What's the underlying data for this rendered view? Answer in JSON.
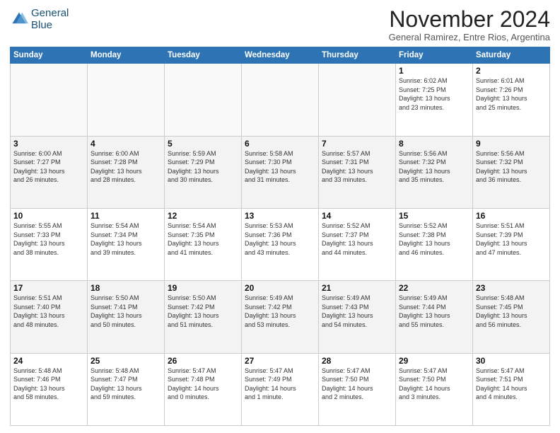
{
  "logo": {
    "line1": "General",
    "line2": "Blue"
  },
  "header": {
    "title": "November 2024",
    "subtitle": "General Ramirez, Entre Rios, Argentina"
  },
  "weekdays": [
    "Sunday",
    "Monday",
    "Tuesday",
    "Wednesday",
    "Thursday",
    "Friday",
    "Saturday"
  ],
  "weeks": [
    [
      {
        "day": "",
        "info": ""
      },
      {
        "day": "",
        "info": ""
      },
      {
        "day": "",
        "info": ""
      },
      {
        "day": "",
        "info": ""
      },
      {
        "day": "",
        "info": ""
      },
      {
        "day": "1",
        "info": "Sunrise: 6:02 AM\nSunset: 7:25 PM\nDaylight: 13 hours\nand 23 minutes."
      },
      {
        "day": "2",
        "info": "Sunrise: 6:01 AM\nSunset: 7:26 PM\nDaylight: 13 hours\nand 25 minutes."
      }
    ],
    [
      {
        "day": "3",
        "info": "Sunrise: 6:00 AM\nSunset: 7:27 PM\nDaylight: 13 hours\nand 26 minutes."
      },
      {
        "day": "4",
        "info": "Sunrise: 6:00 AM\nSunset: 7:28 PM\nDaylight: 13 hours\nand 28 minutes."
      },
      {
        "day": "5",
        "info": "Sunrise: 5:59 AM\nSunset: 7:29 PM\nDaylight: 13 hours\nand 30 minutes."
      },
      {
        "day": "6",
        "info": "Sunrise: 5:58 AM\nSunset: 7:30 PM\nDaylight: 13 hours\nand 31 minutes."
      },
      {
        "day": "7",
        "info": "Sunrise: 5:57 AM\nSunset: 7:31 PM\nDaylight: 13 hours\nand 33 minutes."
      },
      {
        "day": "8",
        "info": "Sunrise: 5:56 AM\nSunset: 7:32 PM\nDaylight: 13 hours\nand 35 minutes."
      },
      {
        "day": "9",
        "info": "Sunrise: 5:56 AM\nSunset: 7:32 PM\nDaylight: 13 hours\nand 36 minutes."
      }
    ],
    [
      {
        "day": "10",
        "info": "Sunrise: 5:55 AM\nSunset: 7:33 PM\nDaylight: 13 hours\nand 38 minutes."
      },
      {
        "day": "11",
        "info": "Sunrise: 5:54 AM\nSunset: 7:34 PM\nDaylight: 13 hours\nand 39 minutes."
      },
      {
        "day": "12",
        "info": "Sunrise: 5:54 AM\nSunset: 7:35 PM\nDaylight: 13 hours\nand 41 minutes."
      },
      {
        "day": "13",
        "info": "Sunrise: 5:53 AM\nSunset: 7:36 PM\nDaylight: 13 hours\nand 43 minutes."
      },
      {
        "day": "14",
        "info": "Sunrise: 5:52 AM\nSunset: 7:37 PM\nDaylight: 13 hours\nand 44 minutes."
      },
      {
        "day": "15",
        "info": "Sunrise: 5:52 AM\nSunset: 7:38 PM\nDaylight: 13 hours\nand 46 minutes."
      },
      {
        "day": "16",
        "info": "Sunrise: 5:51 AM\nSunset: 7:39 PM\nDaylight: 13 hours\nand 47 minutes."
      }
    ],
    [
      {
        "day": "17",
        "info": "Sunrise: 5:51 AM\nSunset: 7:40 PM\nDaylight: 13 hours\nand 48 minutes."
      },
      {
        "day": "18",
        "info": "Sunrise: 5:50 AM\nSunset: 7:41 PM\nDaylight: 13 hours\nand 50 minutes."
      },
      {
        "day": "19",
        "info": "Sunrise: 5:50 AM\nSunset: 7:42 PM\nDaylight: 13 hours\nand 51 minutes."
      },
      {
        "day": "20",
        "info": "Sunrise: 5:49 AM\nSunset: 7:42 PM\nDaylight: 13 hours\nand 53 minutes."
      },
      {
        "day": "21",
        "info": "Sunrise: 5:49 AM\nSunset: 7:43 PM\nDaylight: 13 hours\nand 54 minutes."
      },
      {
        "day": "22",
        "info": "Sunrise: 5:49 AM\nSunset: 7:44 PM\nDaylight: 13 hours\nand 55 minutes."
      },
      {
        "day": "23",
        "info": "Sunrise: 5:48 AM\nSunset: 7:45 PM\nDaylight: 13 hours\nand 56 minutes."
      }
    ],
    [
      {
        "day": "24",
        "info": "Sunrise: 5:48 AM\nSunset: 7:46 PM\nDaylight: 13 hours\nand 58 minutes."
      },
      {
        "day": "25",
        "info": "Sunrise: 5:48 AM\nSunset: 7:47 PM\nDaylight: 13 hours\nand 59 minutes."
      },
      {
        "day": "26",
        "info": "Sunrise: 5:47 AM\nSunset: 7:48 PM\nDaylight: 14 hours\nand 0 minutes."
      },
      {
        "day": "27",
        "info": "Sunrise: 5:47 AM\nSunset: 7:49 PM\nDaylight: 14 hours\nand 1 minute."
      },
      {
        "day": "28",
        "info": "Sunrise: 5:47 AM\nSunset: 7:50 PM\nDaylight: 14 hours\nand 2 minutes."
      },
      {
        "day": "29",
        "info": "Sunrise: 5:47 AM\nSunset: 7:50 PM\nDaylight: 14 hours\nand 3 minutes."
      },
      {
        "day": "30",
        "info": "Sunrise: 5:47 AM\nSunset: 7:51 PM\nDaylight: 14 hours\nand 4 minutes."
      }
    ]
  ]
}
